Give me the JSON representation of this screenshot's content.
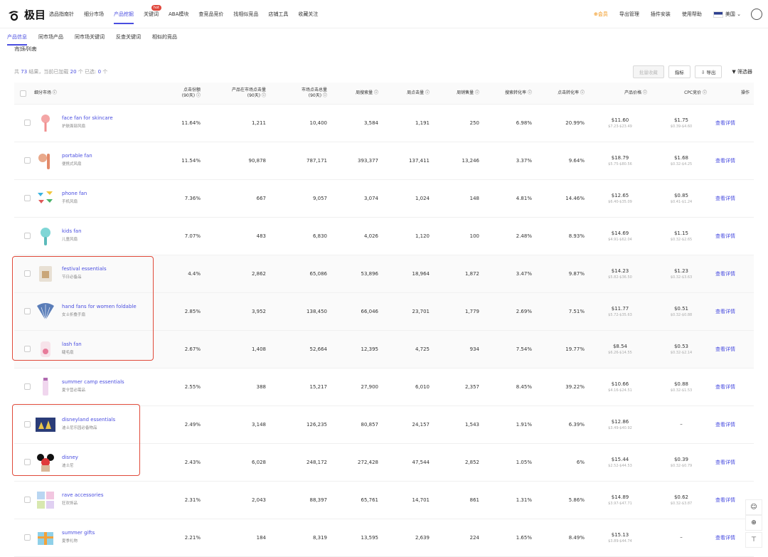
{
  "brand": {
    "logo_text": "极目"
  },
  "nav": {
    "items": [
      {
        "label": "选品指南针",
        "active": false
      },
      {
        "label": "细分市场",
        "active": false
      },
      {
        "label": "产品挖掘",
        "active": true
      },
      {
        "label": "关键词",
        "active": false,
        "badge": "hot"
      },
      {
        "label": "ABA模块",
        "active": false
      },
      {
        "label": "查竞品竞价",
        "active": false
      },
      {
        "label": "找相似竞品",
        "active": false
      },
      {
        "label": "店铺工具",
        "active": false
      },
      {
        "label": "收藏关注",
        "active": false
      }
    ]
  },
  "header_right": {
    "vip": "⊕会员",
    "export": "导出管理",
    "plugin": "插件安装",
    "help": "使用帮助",
    "country": "美国"
  },
  "subtabs": [
    {
      "label": "产品信息",
      "active": true
    },
    {
      "label": "同市场产品",
      "active": false
    },
    {
      "label": "同市场关键词",
      "active": false
    },
    {
      "label": "反查关键词",
      "active": false
    },
    {
      "label": "相似的竞品",
      "active": false
    }
  ],
  "section_title": "市场列表",
  "summary": {
    "prefix": "共",
    "total": "73",
    "mid": "结果，当前已加载",
    "loaded": "20",
    "suffix": "个  已选:",
    "selected": "0",
    "unit": "个"
  },
  "toolbar": {
    "bulk_fav": "批量收藏",
    "metrics": "指标",
    "export": "⇩ 导出",
    "filter": "▼ 筛选器"
  },
  "columns": [
    "细分市场 ⓘ",
    "点击份额\n(90天) ⓘ",
    "产品在市场点击量\n(90天) ⓘ",
    "市场点击总量\n(90天) ⓘ",
    "周搜索量 ⓘ",
    "周点击量 ⓘ",
    "周销售量 ⓘ",
    "搜索转化率 ⓘ",
    "点击转化率 ⓘ",
    "产品价格 ⓘ",
    "CPC竞价 ⓘ",
    "操作"
  ],
  "rows": [
    {
      "en": "face fan for skincare",
      "cn": "护肤面部风扇",
      "share": "11.64%",
      "pclicks": "1,211",
      "mclicks": "10,400",
      "wsearch": "3,584",
      "wclick": "1,191",
      "wsales": "250",
      "scr": "6.98%",
      "ccr": "20.99%",
      "price": "$11.60",
      "prange": "$7.23-$23.49",
      "cpc": "$1.75",
      "crange": "$0.39-$4.60",
      "action": "查看详情",
      "thumb": "fan-pink"
    },
    {
      "en": "portable fan",
      "cn": "便携式风扇",
      "share": "11.54%",
      "pclicks": "90,878",
      "mclicks": "787,171",
      "wsearch": "393,377",
      "wclick": "137,411",
      "wsales": "13,246",
      "scr": "3.37%",
      "ccr": "9.64%",
      "price": "$18.79",
      "prange": "$5.75-$80.56",
      "cpc": "$1.68",
      "crange": "$0.32-$4.25",
      "action": "查看详情",
      "thumb": "fan-orange"
    },
    {
      "en": "phone fan",
      "cn": "手机风扇",
      "share": "7.36%",
      "pclicks": "667",
      "mclicks": "9,057",
      "wsearch": "3,074",
      "wclick": "1,024",
      "wsales": "148",
      "scr": "4.81%",
      "ccr": "14.46%",
      "price": "$12.65",
      "prange": "$6.40-$35.09",
      "cpc": "$0.85",
      "crange": "$0.41-$1.24",
      "action": "查看详情",
      "thumb": "fan-multi"
    },
    {
      "en": "kids fan",
      "cn": "儿童风扇",
      "share": "7.07%",
      "pclicks": "483",
      "mclicks": "6,830",
      "wsearch": "4,026",
      "wclick": "1,120",
      "wsales": "100",
      "scr": "2.48%",
      "ccr": "8.93%",
      "price": "$14.69",
      "prange": "$4.91-$62.04",
      "cpc": "$1.15",
      "crange": "$0.32-$2.65",
      "action": "查看详情",
      "thumb": "fan-teal"
    },
    {
      "en": "festival essentials",
      "cn": "节日必备品",
      "share": "4.4%",
      "pclicks": "2,862",
      "mclicks": "65,086",
      "wsearch": "53,896",
      "wclick": "18,964",
      "wsales": "1,872",
      "scr": "3.47%",
      "ccr": "9.87%",
      "price": "$14.23",
      "prange": "$5.82-$36.50",
      "cpc": "$1.23",
      "crange": "$0.32-$3.63",
      "action": "查看详情",
      "thumb": "bag"
    },
    {
      "en": "hand fans for women foldable",
      "cn": "女士折叠手扇",
      "share": "2.85%",
      "pclicks": "3,952",
      "mclicks": "138,450",
      "wsearch": "66,046",
      "wclick": "23,701",
      "wsales": "1,779",
      "scr": "2.69%",
      "ccr": "7.51%",
      "price": "$11.77",
      "prange": "$5.72-$35.63",
      "cpc": "$0.51",
      "crange": "$0.32-$0.88",
      "action": "查看详情",
      "thumb": "handfan"
    },
    {
      "en": "lash fan",
      "cn": "睫毛扇",
      "share": "2.67%",
      "pclicks": "1,408",
      "mclicks": "52,664",
      "wsearch": "12,395",
      "wclick": "4,725",
      "wsales": "934",
      "scr": "7.54%",
      "ccr": "19.77%",
      "price": "$8.54",
      "prange": "$6.26-$14.55",
      "cpc": "$0.53",
      "crange": "$0.32-$2.14",
      "action": "查看详情",
      "thumb": "lash"
    },
    {
      "en": "summer camp essentials",
      "cn": "夏令营必需品",
      "share": "2.55%",
      "pclicks": "388",
      "mclicks": "15,217",
      "wsearch": "27,900",
      "wclick": "6,010",
      "wsales": "2,357",
      "scr": "8.45%",
      "ccr": "39.22%",
      "price": "$10.66",
      "prange": "$4.16-$24.51",
      "cpc": "$0.88",
      "crange": "$0.32-$1.53",
      "action": "查看详情",
      "thumb": "bottle"
    },
    {
      "en": "disneyland essentials",
      "cn": "迪士尼乐园必备物品",
      "share": "2.49%",
      "pclicks": "3,148",
      "mclicks": "126,235",
      "wsearch": "80,857",
      "wclick": "24,157",
      "wsales": "1,543",
      "scr": "1.91%",
      "ccr": "6.39%",
      "price": "$12.86",
      "prange": "$3.49-$40.92",
      "cpc": "–",
      "crange": "",
      "action": "查看详情",
      "thumb": "castle"
    },
    {
      "en": "disney",
      "cn": "迪士尼",
      "share": "2.43%",
      "pclicks": "6,028",
      "mclicks": "248,172",
      "wsearch": "272,428",
      "wclick": "47,544",
      "wsales": "2,852",
      "scr": "1.05%",
      "ccr": "6%",
      "price": "$15.44",
      "prange": "$2.52-$44.53",
      "cpc": "$0.39",
      "crange": "$0.32-$0.79",
      "action": "查看详情",
      "thumb": "mouse"
    },
    {
      "en": "rave accessories",
      "cn": "狂欢饰品",
      "share": "2.31%",
      "pclicks": "2,043",
      "mclicks": "88,397",
      "wsearch": "65,761",
      "wclick": "14,701",
      "wsales": "861",
      "scr": "1.31%",
      "ccr": "5.86%",
      "price": "$14.89",
      "prange": "$3.97-$47.71",
      "cpc": "$0.62",
      "crange": "$0.32-$3.87",
      "action": "查看详情",
      "thumb": "rave"
    },
    {
      "en": "summer gifts",
      "cn": "夏季礼物",
      "share": "2.21%",
      "pclicks": "184",
      "mclicks": "8,319",
      "wsearch": "13,595",
      "wclick": "2,639",
      "wsales": "224",
      "scr": "1.65%",
      "ccr": "8.49%",
      "price": "$15.13",
      "prange": "$3.89-$44.74",
      "cpc": "–",
      "crange": "",
      "action": "查看详情",
      "thumb": "gift"
    }
  ],
  "colors": {
    "accent": "#4a4ee0",
    "highlight_box": "#e04a3a",
    "vip": "#f08a00"
  }
}
